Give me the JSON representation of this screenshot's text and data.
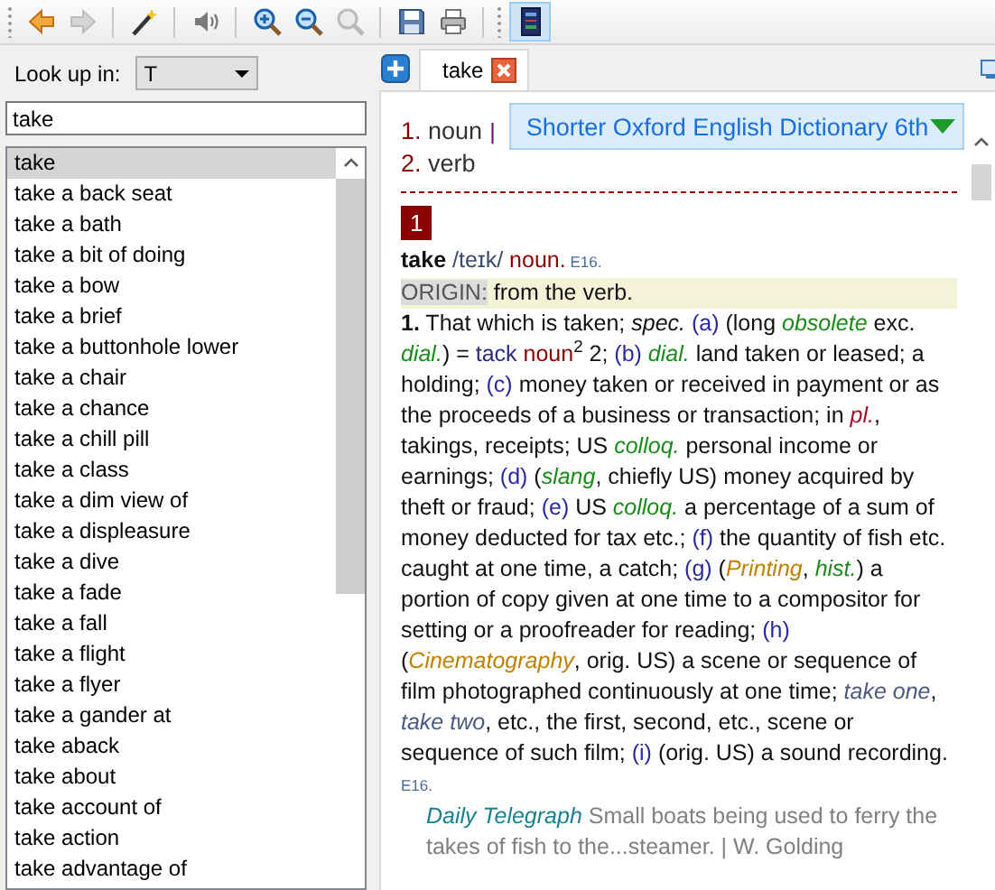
{
  "toolbar": {
    "groups": [
      [
        {
          "kind": "back",
          "disabled": false
        },
        {
          "kind": "forward",
          "disabled": true
        }
      ],
      [
        {
          "kind": "wand",
          "disabled": false
        }
      ],
      [
        {
          "kind": "sound",
          "disabled": false
        }
      ],
      [
        {
          "kind": "zoom_in",
          "disabled": false
        },
        {
          "kind": "zoom_out",
          "disabled": false
        },
        {
          "kind": "zoom_reset",
          "disabled": true
        }
      ],
      [
        {
          "kind": "save",
          "disabled": false
        },
        {
          "kind": "print",
          "disabled": false
        }
      ]
    ],
    "dictionary_buttons": [
      {
        "kind": "dictionary",
        "disabled": false
      }
    ]
  },
  "lookup": {
    "label": "Look up in:",
    "value": "T"
  },
  "search": {
    "value": "take"
  },
  "word_list": [
    {
      "label": "take",
      "selected": true
    },
    {
      "label": "take a back seat",
      "selected": false
    },
    {
      "label": "take a bath",
      "selected": false
    },
    {
      "label": "take a bit of doing",
      "selected": false
    },
    {
      "label": "take a bow",
      "selected": false
    },
    {
      "label": "take a brief",
      "selected": false
    },
    {
      "label": "take a buttonhole lower",
      "selected": false
    },
    {
      "label": "take a chair",
      "selected": false
    },
    {
      "label": "take a chance",
      "selected": false
    },
    {
      "label": "take a chill pill",
      "selected": false
    },
    {
      "label": "take a class",
      "selected": false
    },
    {
      "label": "take a dim view of",
      "selected": false
    },
    {
      "label": "take a displeasure",
      "selected": false
    },
    {
      "label": "take a dive",
      "selected": false
    },
    {
      "label": "take a fade",
      "selected": false
    },
    {
      "label": "take a fall",
      "selected": false
    },
    {
      "label": "take a flight",
      "selected": false
    },
    {
      "label": "take a flyer",
      "selected": false
    },
    {
      "label": "take a gander at",
      "selected": false
    },
    {
      "label": "take aback",
      "selected": false
    },
    {
      "label": "take about",
      "selected": false
    },
    {
      "label": "take account of",
      "selected": false
    },
    {
      "label": "take action",
      "selected": false
    },
    {
      "label": "take advantage of",
      "selected": false
    }
  ],
  "tabs": [
    {
      "label": "take",
      "selected": true
    }
  ],
  "article": {
    "pos_links": [
      {
        "number": "1.",
        "label": "noun"
      },
      {
        "number": "2.",
        "label": "verb"
      }
    ],
    "separator": "|",
    "dictionary_selector": "Shorter Oxford English Dictionary 6th",
    "badge": "1",
    "headword": [
      {
        "kind": "bold",
        "text": "take"
      },
      {
        "kind": "pron",
        "text": " /teɪk/"
      },
      {
        "kind": "pos",
        "text": " noun."
      },
      {
        "kind": "date",
        "text": " E16."
      }
    ],
    "origin": {
      "label": "ORIGIN:",
      "text": "from the verb."
    },
    "sense": [
      {
        "kind": "bold",
        "text": "1."
      },
      {
        "kind": "plain",
        "text": " That which is taken; "
      },
      {
        "kind": "italic",
        "text": "spec."
      },
      {
        "kind": "letter",
        "text": " (a)"
      },
      {
        "kind": "plain",
        "text": " (long "
      },
      {
        "kind": "label",
        "text": "obsolete"
      },
      {
        "kind": "plain",
        "text": " exc. "
      },
      {
        "kind": "label",
        "text": "dial."
      },
      {
        "kind": "plain",
        "text": ") = "
      },
      {
        "kind": "xref",
        "text": "tack"
      },
      {
        "kind": "pos",
        "text": " noun"
      },
      {
        "kind": "sup",
        "text": "2"
      },
      {
        "kind": "plain",
        "text": " 2; "
      },
      {
        "kind": "letter",
        "text": "(b)"
      },
      {
        "kind": "label",
        "text": " dial."
      },
      {
        "kind": "plain",
        "text": " land taken or leased; a holding; "
      },
      {
        "kind": "letter",
        "text": "(c)"
      },
      {
        "kind": "plain",
        "text": " money taken or received in payment or as the proceeds of a business or transaction; in "
      },
      {
        "kind": "gram",
        "text": "pl."
      },
      {
        "kind": "plain",
        "text": ", takings, receipts; US "
      },
      {
        "kind": "label",
        "text": "colloq."
      },
      {
        "kind": "plain",
        "text": " personal income or earnings; "
      },
      {
        "kind": "letter",
        "text": "(d)"
      },
      {
        "kind": "plain",
        "text": " ("
      },
      {
        "kind": "label",
        "text": "slang"
      },
      {
        "kind": "plain",
        "text": ", chiefly US) money acquired by theft or fraud; "
      },
      {
        "kind": "letter",
        "text": "(e)"
      },
      {
        "kind": "plain",
        "text": " US "
      },
      {
        "kind": "label",
        "text": "colloq."
      },
      {
        "kind": "plain",
        "text": " a percentage of a sum of money deducted for tax etc.; "
      },
      {
        "kind": "letter",
        "text": "(f)"
      },
      {
        "kind": "plain",
        "text": " the quantity of fish etc. caught at one time, a catch; "
      },
      {
        "kind": "letter",
        "text": "(g)"
      },
      {
        "kind": "plain",
        "text": " ("
      },
      {
        "kind": "subject",
        "text": "Printing"
      },
      {
        "kind": "plain",
        "text": ", "
      },
      {
        "kind": "label",
        "text": "hist."
      },
      {
        "kind": "plain",
        "text": ") a portion of copy given at one time to a compositor for setting or a proofreader for reading; "
      },
      {
        "kind": "letter",
        "text": "(h)"
      },
      {
        "kind": "plain",
        "text": " ("
      },
      {
        "kind": "subject",
        "text": "Cinematography"
      },
      {
        "kind": "plain",
        "text": ", orig. US) a scene or sequence of film photographed continuously at one time; "
      },
      {
        "kind": "example",
        "text": "take one"
      },
      {
        "kind": "plain",
        "text": ", "
      },
      {
        "kind": "example",
        "text": "take two"
      },
      {
        "kind": "plain",
        "text": ", etc., the first, second, etc., scene or sequence of such film; "
      },
      {
        "kind": "letter",
        "text": "(i)"
      },
      {
        "kind": "plain",
        "text": " (orig. US) a sound recording. "
      },
      {
        "kind": "date",
        "text": "E16."
      }
    ],
    "quotation": [
      {
        "kind": "source",
        "text": "Daily Telegraph"
      },
      {
        "kind": "quote",
        "text": " Small boats being used to ferry the takes of fish to the...steamer. | W. Golding"
      }
    ]
  }
}
